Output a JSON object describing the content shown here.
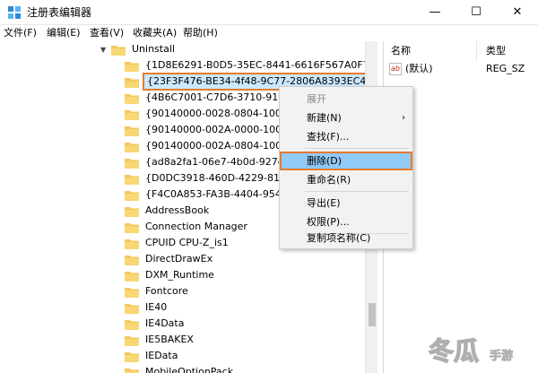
{
  "window": {
    "title": "注册表编辑器",
    "minimize": "—",
    "maximize": "☐",
    "close": "✕",
    "app_icon": "registry-editor-icon"
  },
  "menu": [
    "文件(F)",
    "编辑(E)",
    "查看(V)",
    "收藏夹(A)",
    "帮助(H)"
  ],
  "tree": {
    "parent": "Uninstall",
    "items": [
      "{1D8E6291-B0D5-35EC-8441-6616F567A0F7}",
      "{23F3F476-BE34-4f48-9C77-2806A8393EC4}",
      "{4B6C7001-C7D6-3710-913E-5",
      "{90140000-0028-0804-1000-0",
      "{90140000-002A-0000-1000-0",
      "{90140000-002A-0804-1000-0",
      "{ad8a2fa1-06e7-4b0d-927d-6",
      "{D0DC3918-460D-4229-811E-",
      "{F4C0A853-FA3B-4404-954B-7",
      "AddressBook",
      "Connection Manager",
      "CPUID CPU-Z_is1",
      "DirectDrawEx",
      "DXM_Runtime",
      "Fontcore",
      "IE40",
      "IE4Data",
      "IE5BAKEX",
      "IEData",
      "MobileOptionPack"
    ],
    "selected_index": 1
  },
  "values_pane": {
    "col_name": "名称",
    "col_type": "类型",
    "rows": [
      {
        "name": "(默认)",
        "type": "REG_SZ"
      }
    ]
  },
  "context_menu": {
    "items": [
      {
        "label": "展开",
        "disabled": true
      },
      {
        "label": "新建(N)",
        "submenu": true
      },
      {
        "label": "查找(F)..."
      },
      {
        "label": "删除(D)",
        "highlighted": true
      },
      {
        "label": "重命名(R)"
      },
      {
        "label": "导出(E)"
      },
      {
        "label": "权限(P)..."
      },
      {
        "label": "复制项名称(C)"
      }
    ],
    "submenu_arrow": "›"
  },
  "watermark": {
    "main": "冬瓜",
    "sub": "手游"
  },
  "colors": {
    "highlight_border": "#e87a2e",
    "menu_highlight": "#91c9f7",
    "folder": "#f4c85a"
  }
}
